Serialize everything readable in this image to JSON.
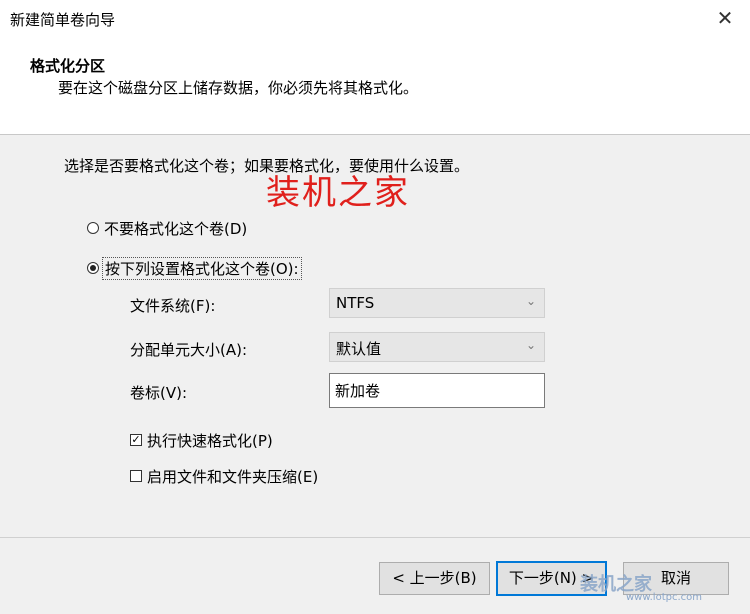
{
  "window": {
    "title": "新建简单卷向导",
    "close_glyph": "✕"
  },
  "header": {
    "title": "格式化分区",
    "subtitle": "要在这个磁盘分区上储存数据，你必须先将其格式化。"
  },
  "main": {
    "lead": "选择是否要格式化这个卷；如果要格式化，要使用什么设置。",
    "watermark": "装机之家",
    "options": [
      {
        "label": "不要格式化这个卷(D)",
        "selected": false
      },
      {
        "label": "按下列设置格式化这个卷(O):",
        "selected": true
      }
    ],
    "file_system": {
      "label": "文件系统(F):",
      "value": "NTFS"
    },
    "allocation": {
      "label": "分配单元大小(A):",
      "value": "默认值"
    },
    "volume_label": {
      "label": "卷标(V):",
      "value": "新加卷"
    },
    "quick_format": {
      "label": "执行快速格式化(P)",
      "checked": true
    },
    "compression": {
      "label": "启用文件和文件夹压缩(E)",
      "checked": false
    }
  },
  "footer": {
    "back_label": "< 上一步(B)",
    "next_label": "下一步(N) >",
    "cancel_label": "取消",
    "watermark": "装机之家",
    "watermark_url": "www.lotpc.com"
  },
  "icons": {
    "combo_chevron": "chevron-down-icon",
    "check": "✓"
  },
  "colors": {
    "accent": "#0078d7",
    "watermark_red": "#e0201c"
  }
}
